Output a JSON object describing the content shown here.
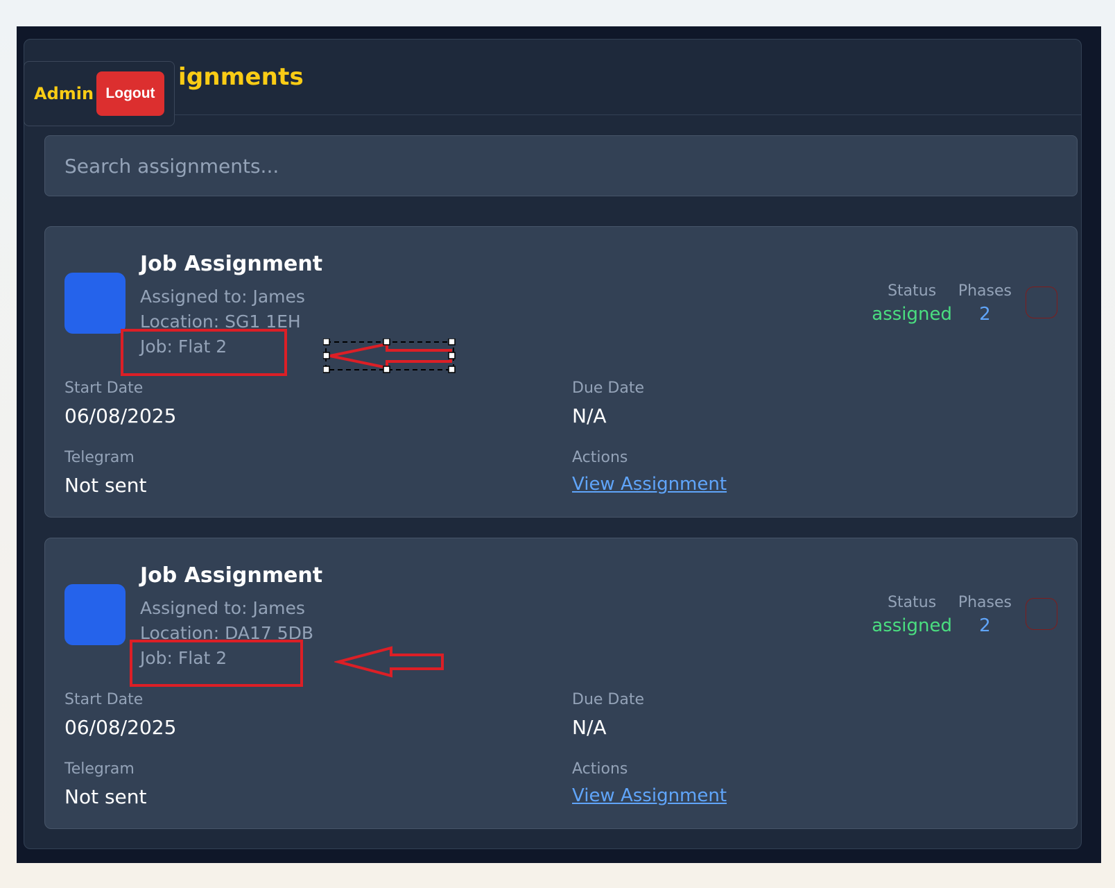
{
  "header": {
    "title_visible": "ignments",
    "admin_label": "Admin",
    "logout_label": "Logout"
  },
  "search": {
    "placeholder": "Search assignments..."
  },
  "labels": {
    "status": "Status",
    "phases": "Phases",
    "start_date": "Start Date",
    "due_date": "Due Date",
    "telegram": "Telegram",
    "actions": "Actions"
  },
  "assignments": [
    {
      "title": "Job Assignment",
      "assigned_to": "Assigned to: James",
      "location": "Location: SG1 1EH",
      "job": "Job: Flat 2",
      "status": "assigned",
      "phases": "2",
      "start_date": "06/08/2025",
      "due_date": "N/A",
      "telegram": "Not sent",
      "action_label": "View Assignment"
    },
    {
      "title": "Job Assignment",
      "assigned_to": "Assigned to: James",
      "location": "Location: DA17 5DB",
      "job": "Job: Flat 2",
      "status": "assigned",
      "phases": "2",
      "start_date": "06/08/2025",
      "due_date": "N/A",
      "telegram": "Not sent",
      "action_label": "View Assignment"
    }
  ],
  "colors": {
    "accent_yellow": "#facc15",
    "logout_red": "#dc2f2f",
    "status_green": "#4ade80",
    "phase_blue": "#60a5fa",
    "annotation_red": "#dc1f26"
  }
}
